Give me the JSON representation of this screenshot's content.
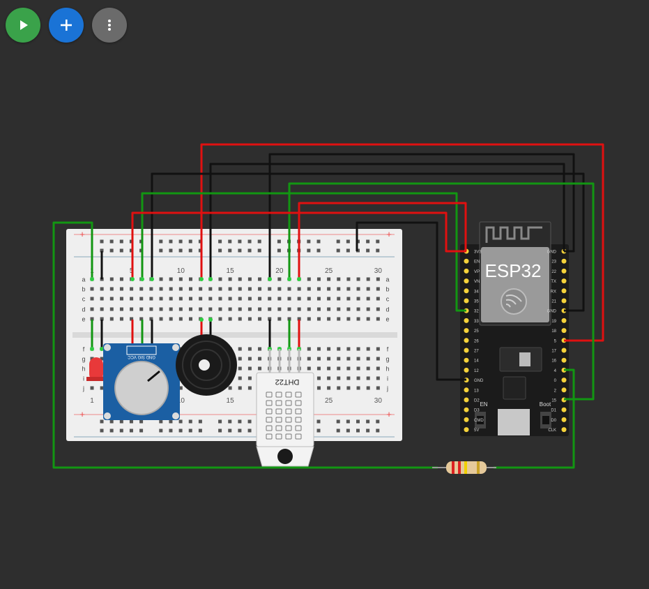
{
  "toolbar": {
    "play_icon": "play-icon",
    "add_icon": "plus-icon",
    "more_icon": "more-vertical-icon"
  },
  "breadboard": {
    "col_labels": [
      "1",
      "5",
      "10",
      "15",
      "20",
      "25",
      "30"
    ],
    "row_labels_top": [
      "a",
      "b",
      "c",
      "d",
      "e"
    ],
    "row_labels_bottom": [
      "f",
      "g",
      "h",
      "i",
      "j"
    ],
    "plus": "+",
    "minus": "-"
  },
  "esp32": {
    "title": "ESP32",
    "btn_en": "EN",
    "btn_boot": "Boot",
    "left_pins": [
      "3V3",
      "EN",
      "VP",
      "VN",
      "34",
      "35",
      "32",
      "33",
      "25",
      "26",
      "27",
      "14",
      "12",
      "GND",
      "13",
      "D2",
      "D3",
      "CMD",
      "5V"
    ],
    "right_pins": [
      "GND",
      "23",
      "22",
      "TX",
      "RX",
      "21",
      "GND",
      "19",
      "18",
      "5",
      "17",
      "16",
      "4",
      "0",
      "2",
      "15",
      "D1",
      "D0",
      "CLK"
    ]
  },
  "dht": {
    "label": "DHT22"
  },
  "pot": {
    "pin_labels": "GND SIG VCC"
  },
  "colors": {
    "background": "#2e2e2e",
    "breadboard": "#efefef",
    "wire_red": "#e01010",
    "wire_black": "#111111",
    "wire_green": "#129612",
    "esp32_board": "#1b1b1b",
    "pot_board": "#1b5fa3",
    "led": "#e8393a"
  }
}
